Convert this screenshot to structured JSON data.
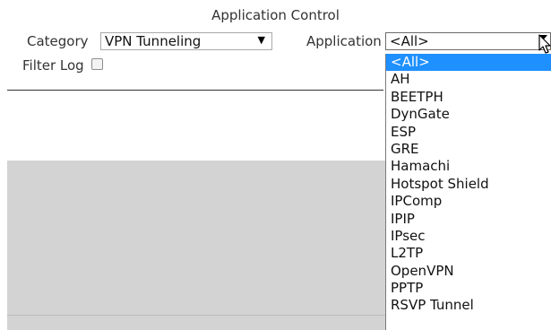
{
  "title": "Application Control",
  "category": {
    "label": "Category",
    "value": "VPN Tunneling"
  },
  "application": {
    "label": "Application",
    "value": "<All>"
  },
  "filter_log": {
    "label": "Filter Log",
    "checked": false
  },
  "dropdown": {
    "options": [
      "<All>",
      "AH",
      "BEETPH",
      "DynGate",
      "ESP",
      "GRE",
      "Hamachi",
      "Hotspot Shield",
      "IPComp",
      "IPIP",
      "IPsec",
      "L2TP",
      "OpenVPN",
      "PPTP",
      "RSVP Tunnel"
    ],
    "selected_index": 0
  },
  "colors": {
    "selected_bg": "#1e90ff",
    "panel_gray": "#d3d3d3"
  }
}
